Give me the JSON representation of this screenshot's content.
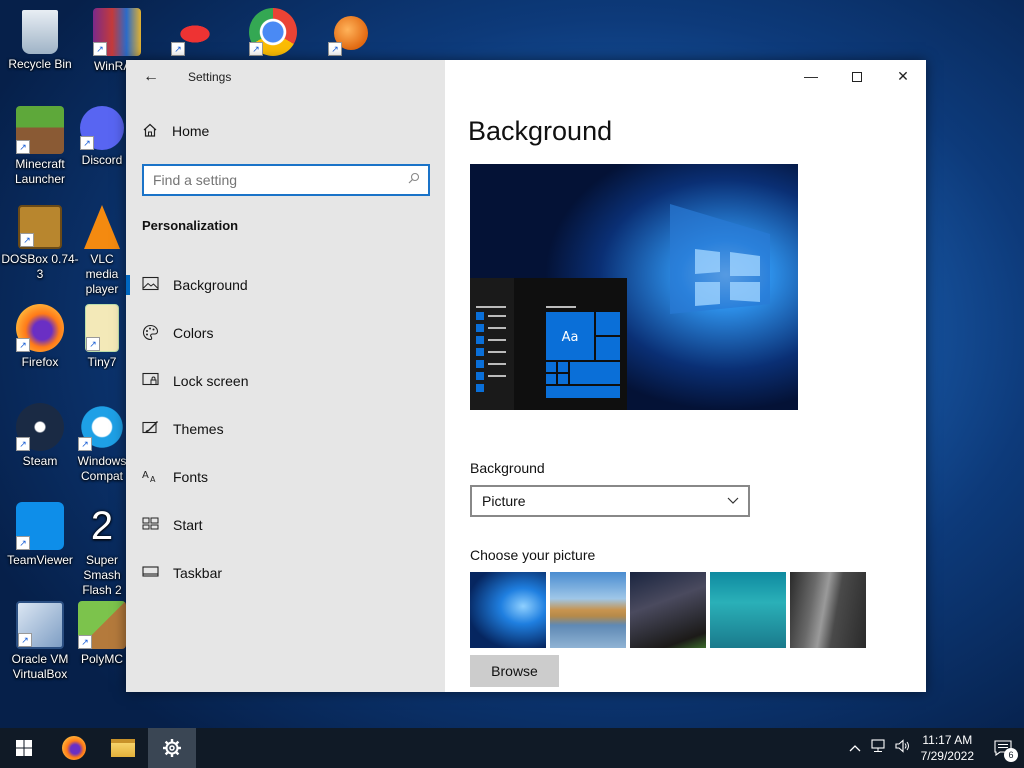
{
  "desktop": {
    "icons": [
      {
        "label": "Recycle Bin"
      },
      {
        "label": "WinRAR"
      },
      {
        "label": ""
      },
      {
        "label": ""
      },
      {
        "label": ""
      },
      {
        "label": "Minecraft Launcher"
      },
      {
        "label": "Discord"
      },
      {
        "label": "DOSBox 0.74-3"
      },
      {
        "label": "VLC media player"
      },
      {
        "label": "Firefox"
      },
      {
        "label": "Tiny7"
      },
      {
        "label": "Steam"
      },
      {
        "label": "Windows Compat"
      },
      {
        "label": "TeamViewer"
      },
      {
        "label": "Super Smash Flash 2"
      },
      {
        "label": "Oracle VM VirtualBox"
      },
      {
        "label": "PolyMC"
      }
    ]
  },
  "settings": {
    "window_title": "Settings",
    "nav": {
      "home_label": "Home",
      "search_placeholder": "Find a setting",
      "section_title": "Personalization",
      "items": [
        {
          "label": "Background",
          "icon": "picture-icon",
          "active": true
        },
        {
          "label": "Colors",
          "icon": "palette-icon"
        },
        {
          "label": "Lock screen",
          "icon": "lock-screen-icon"
        },
        {
          "label": "Themes",
          "icon": "themes-icon"
        },
        {
          "label": "Fonts",
          "icon": "fonts-icon"
        },
        {
          "label": "Start",
          "icon": "start-icon"
        },
        {
          "label": "Taskbar",
          "icon": "taskbar-icon"
        }
      ]
    },
    "main": {
      "page_title": "Background",
      "preview_tile_text": "Aa",
      "background_label": "Background",
      "background_selected": "Picture",
      "choose_picture_label": "Choose your picture",
      "browse_label": "Browse"
    },
    "accent": "#0067c0"
  },
  "taskbar": {
    "time": "11:17 AM",
    "date": "7/29/2022",
    "notification_count": "6"
  }
}
